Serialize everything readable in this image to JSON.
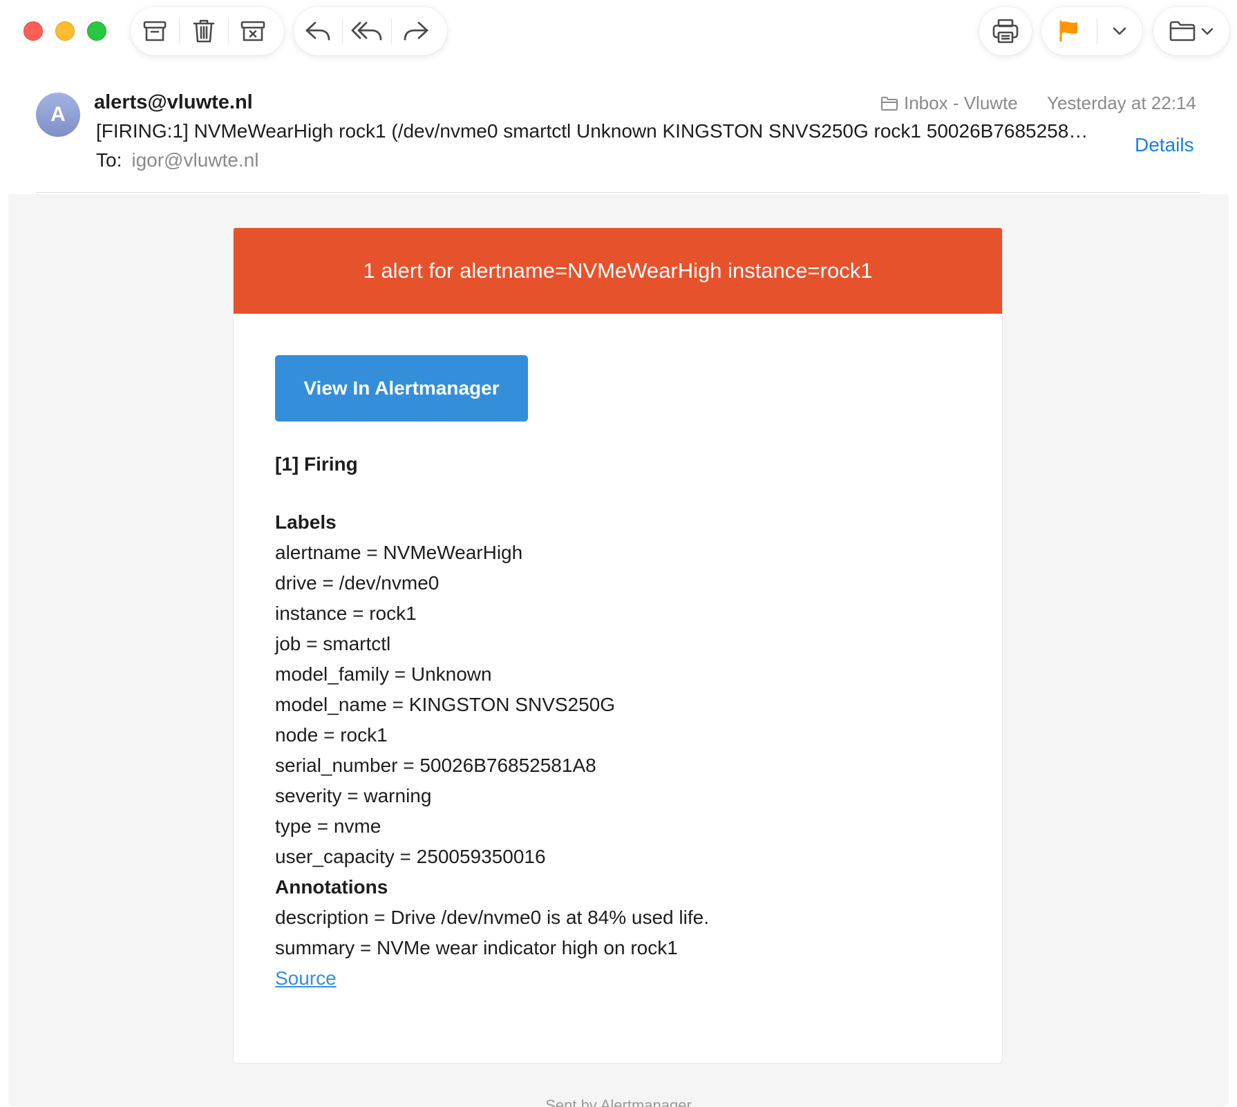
{
  "toolbar": {
    "colors": {
      "flag": "#ff9500",
      "close": "#ff5f57",
      "minimize": "#febc2e",
      "zoom": "#28c840"
    },
    "icons": [
      "archive-icon",
      "trash-icon",
      "junk-icon",
      "reply-icon",
      "reply-all-icon",
      "forward-icon",
      "print-icon",
      "flag-icon",
      "chevron-down-icon",
      "folder-icon"
    ]
  },
  "message": {
    "avatar_initial": "A",
    "sender": "alerts@vluwte.nl",
    "subject": "[FIRING:1] NVMeWearHigh rock1 (/dev/nvme0 smartctl Unknown KINGSTON SNVS250G rock1 50026B7685258…",
    "to_label": "To:",
    "to_value": "igor@vluwte.nl",
    "mailbox": "Inbox - Vluwte",
    "date": "Yesterday at 22:14",
    "details_label": "Details"
  },
  "alert": {
    "header": "1 alert for alertname=NVMeWearHigh instance=rock1",
    "header_color": "#e6522c",
    "button_label": "View In Alertmanager",
    "button_color": "#348eda",
    "firing_title": "[1] Firing",
    "labels_title": "Labels",
    "labels": [
      "alertname = NVMeWearHigh",
      "drive = /dev/nvme0",
      "instance = rock1",
      "job = smartctl",
      "model_family = Unknown",
      "model_name = KINGSTON SNVS250G",
      "node = rock1",
      "serial_number = 50026B76852581A8",
      "severity = warning",
      "type = nvme",
      "user_capacity = 250059350016"
    ],
    "annotations_title": "Annotations",
    "annotations": [
      "description = Drive /dev/nvme0 is at 84% used life.",
      "summary = NVMe wear indicator high on rock1"
    ],
    "source_label": "Source"
  },
  "footer": "Sent by Alertmanager"
}
